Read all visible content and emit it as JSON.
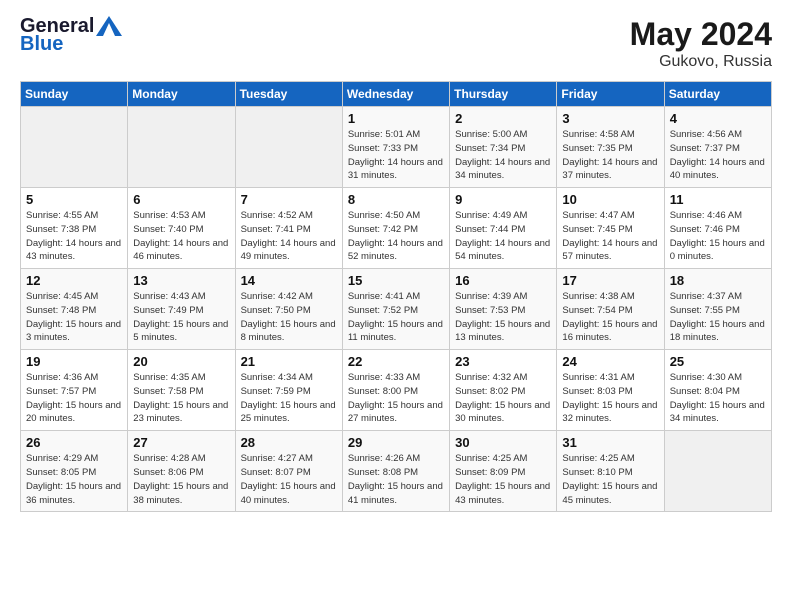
{
  "header": {
    "logo_line1": "General",
    "logo_line2": "Blue",
    "month": "May 2024",
    "location": "Gukovo, Russia"
  },
  "weekdays": [
    "Sunday",
    "Monday",
    "Tuesday",
    "Wednesday",
    "Thursday",
    "Friday",
    "Saturday"
  ],
  "weeks": [
    [
      {
        "day": "",
        "sunrise": "",
        "sunset": "",
        "daylight": ""
      },
      {
        "day": "",
        "sunrise": "",
        "sunset": "",
        "daylight": ""
      },
      {
        "day": "",
        "sunrise": "",
        "sunset": "",
        "daylight": ""
      },
      {
        "day": "1",
        "sunrise": "Sunrise: 5:01 AM",
        "sunset": "Sunset: 7:33 PM",
        "daylight": "Daylight: 14 hours and 31 minutes."
      },
      {
        "day": "2",
        "sunrise": "Sunrise: 5:00 AM",
        "sunset": "Sunset: 7:34 PM",
        "daylight": "Daylight: 14 hours and 34 minutes."
      },
      {
        "day": "3",
        "sunrise": "Sunrise: 4:58 AM",
        "sunset": "Sunset: 7:35 PM",
        "daylight": "Daylight: 14 hours and 37 minutes."
      },
      {
        "day": "4",
        "sunrise": "Sunrise: 4:56 AM",
        "sunset": "Sunset: 7:37 PM",
        "daylight": "Daylight: 14 hours and 40 minutes."
      }
    ],
    [
      {
        "day": "5",
        "sunrise": "Sunrise: 4:55 AM",
        "sunset": "Sunset: 7:38 PM",
        "daylight": "Daylight: 14 hours and 43 minutes."
      },
      {
        "day": "6",
        "sunrise": "Sunrise: 4:53 AM",
        "sunset": "Sunset: 7:40 PM",
        "daylight": "Daylight: 14 hours and 46 minutes."
      },
      {
        "day": "7",
        "sunrise": "Sunrise: 4:52 AM",
        "sunset": "Sunset: 7:41 PM",
        "daylight": "Daylight: 14 hours and 49 minutes."
      },
      {
        "day": "8",
        "sunrise": "Sunrise: 4:50 AM",
        "sunset": "Sunset: 7:42 PM",
        "daylight": "Daylight: 14 hours and 52 minutes."
      },
      {
        "day": "9",
        "sunrise": "Sunrise: 4:49 AM",
        "sunset": "Sunset: 7:44 PM",
        "daylight": "Daylight: 14 hours and 54 minutes."
      },
      {
        "day": "10",
        "sunrise": "Sunrise: 4:47 AM",
        "sunset": "Sunset: 7:45 PM",
        "daylight": "Daylight: 14 hours and 57 minutes."
      },
      {
        "day": "11",
        "sunrise": "Sunrise: 4:46 AM",
        "sunset": "Sunset: 7:46 PM",
        "daylight": "Daylight: 15 hours and 0 minutes."
      }
    ],
    [
      {
        "day": "12",
        "sunrise": "Sunrise: 4:45 AM",
        "sunset": "Sunset: 7:48 PM",
        "daylight": "Daylight: 15 hours and 3 minutes."
      },
      {
        "day": "13",
        "sunrise": "Sunrise: 4:43 AM",
        "sunset": "Sunset: 7:49 PM",
        "daylight": "Daylight: 15 hours and 5 minutes."
      },
      {
        "day": "14",
        "sunrise": "Sunrise: 4:42 AM",
        "sunset": "Sunset: 7:50 PM",
        "daylight": "Daylight: 15 hours and 8 minutes."
      },
      {
        "day": "15",
        "sunrise": "Sunrise: 4:41 AM",
        "sunset": "Sunset: 7:52 PM",
        "daylight": "Daylight: 15 hours and 11 minutes."
      },
      {
        "day": "16",
        "sunrise": "Sunrise: 4:39 AM",
        "sunset": "Sunset: 7:53 PM",
        "daylight": "Daylight: 15 hours and 13 minutes."
      },
      {
        "day": "17",
        "sunrise": "Sunrise: 4:38 AM",
        "sunset": "Sunset: 7:54 PM",
        "daylight": "Daylight: 15 hours and 16 minutes."
      },
      {
        "day": "18",
        "sunrise": "Sunrise: 4:37 AM",
        "sunset": "Sunset: 7:55 PM",
        "daylight": "Daylight: 15 hours and 18 minutes."
      }
    ],
    [
      {
        "day": "19",
        "sunrise": "Sunrise: 4:36 AM",
        "sunset": "Sunset: 7:57 PM",
        "daylight": "Daylight: 15 hours and 20 minutes."
      },
      {
        "day": "20",
        "sunrise": "Sunrise: 4:35 AM",
        "sunset": "Sunset: 7:58 PM",
        "daylight": "Daylight: 15 hours and 23 minutes."
      },
      {
        "day": "21",
        "sunrise": "Sunrise: 4:34 AM",
        "sunset": "Sunset: 7:59 PM",
        "daylight": "Daylight: 15 hours and 25 minutes."
      },
      {
        "day": "22",
        "sunrise": "Sunrise: 4:33 AM",
        "sunset": "Sunset: 8:00 PM",
        "daylight": "Daylight: 15 hours and 27 minutes."
      },
      {
        "day": "23",
        "sunrise": "Sunrise: 4:32 AM",
        "sunset": "Sunset: 8:02 PM",
        "daylight": "Daylight: 15 hours and 30 minutes."
      },
      {
        "day": "24",
        "sunrise": "Sunrise: 4:31 AM",
        "sunset": "Sunset: 8:03 PM",
        "daylight": "Daylight: 15 hours and 32 minutes."
      },
      {
        "day": "25",
        "sunrise": "Sunrise: 4:30 AM",
        "sunset": "Sunset: 8:04 PM",
        "daylight": "Daylight: 15 hours and 34 minutes."
      }
    ],
    [
      {
        "day": "26",
        "sunrise": "Sunrise: 4:29 AM",
        "sunset": "Sunset: 8:05 PM",
        "daylight": "Daylight: 15 hours and 36 minutes."
      },
      {
        "day": "27",
        "sunrise": "Sunrise: 4:28 AM",
        "sunset": "Sunset: 8:06 PM",
        "daylight": "Daylight: 15 hours and 38 minutes."
      },
      {
        "day": "28",
        "sunrise": "Sunrise: 4:27 AM",
        "sunset": "Sunset: 8:07 PM",
        "daylight": "Daylight: 15 hours and 40 minutes."
      },
      {
        "day": "29",
        "sunrise": "Sunrise: 4:26 AM",
        "sunset": "Sunset: 8:08 PM",
        "daylight": "Daylight: 15 hours and 41 minutes."
      },
      {
        "day": "30",
        "sunrise": "Sunrise: 4:25 AM",
        "sunset": "Sunset: 8:09 PM",
        "daylight": "Daylight: 15 hours and 43 minutes."
      },
      {
        "day": "31",
        "sunrise": "Sunrise: 4:25 AM",
        "sunset": "Sunset: 8:10 PM",
        "daylight": "Daylight: 15 hours and 45 minutes."
      },
      {
        "day": "",
        "sunrise": "",
        "sunset": "",
        "daylight": ""
      }
    ]
  ]
}
